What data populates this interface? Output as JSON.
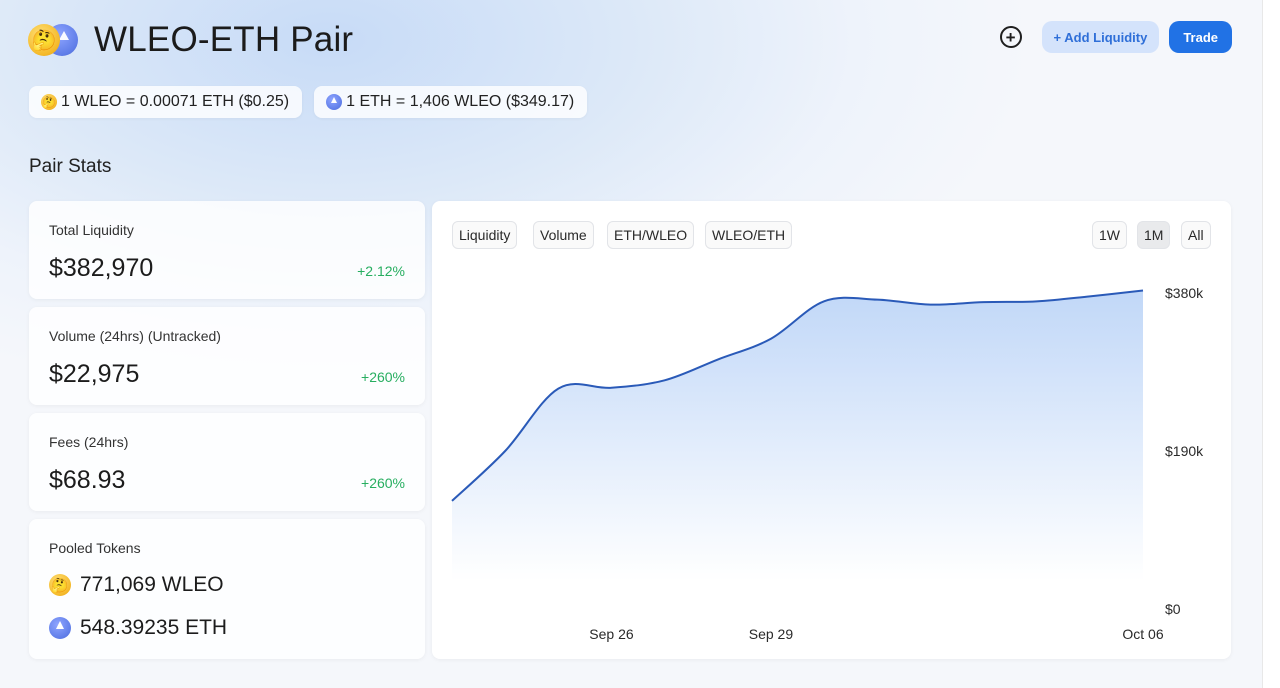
{
  "header": {
    "title": "WLEO-ETH Pair",
    "add_liquidity_label": "+ Add Liquidity",
    "trade_label": "Trade",
    "icons": [
      "thinking-face-icon",
      "ethereum-icon",
      "plus-circle-icon"
    ]
  },
  "prices": {
    "wleo_price": "1 WLEO = 0.00071 ETH ($0.25)",
    "eth_price": "1 ETH = 1,406 WLEO ($349.17)"
  },
  "pair_stats": {
    "section_title": "Pair Stats",
    "total_liquidity": {
      "label": "Total Liquidity",
      "value": "$382,970",
      "change": "+2.12%"
    },
    "volume": {
      "label": "Volume (24hrs) (Untracked)",
      "value": "$22,975",
      "change": "+260%"
    },
    "fees": {
      "label": "Fees (24hrs)",
      "value": "$68.93",
      "change": "+260%"
    },
    "pooled_tokens": {
      "label": "Pooled Tokens",
      "wleo": "771,069 WLEO",
      "eth": "548.39235 ETH"
    }
  },
  "chart_controls": {
    "tabs": [
      "Liquidity",
      "Volume",
      "ETH/WLEO",
      "WLEO/ETH"
    ],
    "ranges": [
      "1W",
      "1M",
      "All"
    ],
    "active_range": "1M"
  },
  "colors": {
    "accent": "#2172e5",
    "positive": "#27ae60",
    "line": "#2a5ab8"
  },
  "chart_data": {
    "type": "area",
    "x": [
      "Sep 23",
      "Sep 24",
      "Sep 25",
      "Sep 26",
      "Sep 27",
      "Sep 28",
      "Sep 29",
      "Sep 30",
      "Oct 01",
      "Oct 02",
      "Oct 03",
      "Oct 04",
      "Oct 05",
      "Oct 06"
    ],
    "values": [
      130000,
      190000,
      265000,
      266000,
      275000,
      300000,
      325000,
      370000,
      372000,
      366000,
      369000,
      370000,
      376000,
      382970
    ],
    "x_tick_labels": [
      "Sep 26",
      "Sep 29",
      "Oct 06"
    ],
    "y_tick_labels": [
      "$380k",
      "$190k",
      "$0"
    ],
    "y_tick_values": [
      380000,
      190000,
      0
    ],
    "ylim": [
      0,
      380000
    ],
    "grid": false
  }
}
